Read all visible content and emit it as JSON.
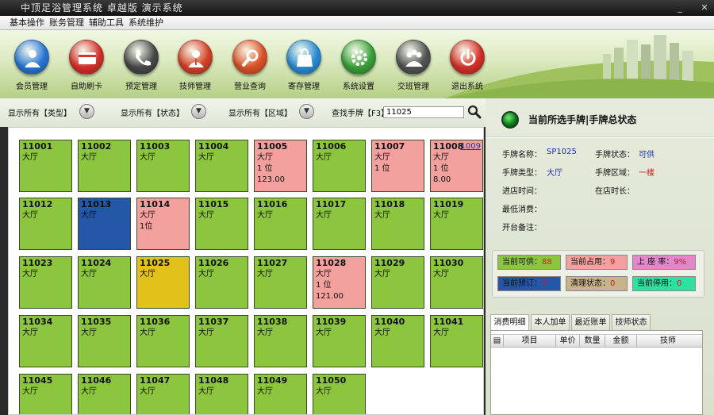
{
  "window": {
    "title": "中顶足浴管理系统  卓越版  演示系统"
  },
  "menu": [
    "基本操作",
    "账务管理",
    "辅助工具",
    "系统维护"
  ],
  "toolbar": [
    {
      "label": "会员管理",
      "icon": "member-icon",
      "color": "#2a78d8"
    },
    {
      "label": "自助刷卡",
      "icon": "card-icon",
      "color": "#d8332a"
    },
    {
      "label": "预定管理",
      "icon": "phone-icon",
      "color": "#4a4a4a"
    },
    {
      "label": "技师管理",
      "icon": "technician-icon",
      "color": "#d8432a"
    },
    {
      "label": "营业查询",
      "icon": "search-icon",
      "color": "#e0552a"
    },
    {
      "label": "寄存管理",
      "icon": "bag-icon",
      "color": "#2b8fd8"
    },
    {
      "label": "系统设置",
      "icon": "gear-icon",
      "color": "#3ba43a"
    },
    {
      "label": "交班管理",
      "icon": "shift-icon",
      "color": "#555555"
    },
    {
      "label": "退出系统",
      "icon": "power-icon",
      "color": "#d8332a"
    }
  ],
  "filters": {
    "type": "显示所有【类型】",
    "state": "显示所有【状态】",
    "area": "显示所有【区域】",
    "search_label": "查找手牌【F3】",
    "search_value": "11025"
  },
  "colors": {
    "available": "#8cc63f",
    "occupied": "#f2a19e",
    "reserved": "#2457a8",
    "cleaning": "#e2c21a",
    "disabled": "#2fe0a0"
  },
  "cards": [
    {
      "num": "11001",
      "area": "大厅",
      "status": "available"
    },
    {
      "num": "11002",
      "area": "大厅",
      "status": "available"
    },
    {
      "num": "11003",
      "area": "大厅",
      "status": "available"
    },
    {
      "num": "11004",
      "area": "大厅",
      "status": "available"
    },
    {
      "num": "11005",
      "area": "大厅",
      "seat": "1 位",
      "amount": "123.00",
      "status": "occupied"
    },
    {
      "num": "11006",
      "area": "大厅",
      "status": "available"
    },
    {
      "num": "11007",
      "area": "大厅",
      "seat": "1 位",
      "status": "occupied"
    },
    {
      "num": "11008",
      "link": "1009",
      "area": "大厅",
      "seat": "1 位",
      "amount": "8.00",
      "status": "occupied"
    },
    {
      "num": "11012",
      "area": "大厅",
      "status": "available"
    },
    {
      "num": "11013",
      "area": "大厅",
      "status": "reserved"
    },
    {
      "num": "11014",
      "area": "大厅",
      "seat": "1位",
      "status": "occupied"
    },
    {
      "num": "11015",
      "area": "大厅",
      "status": "available"
    },
    {
      "num": "11016",
      "area": "大厅",
      "status": "available"
    },
    {
      "num": "11017",
      "area": "大厅",
      "status": "available"
    },
    {
      "num": "11018",
      "area": "大厅",
      "status": "available"
    },
    {
      "num": "11019",
      "area": "大厅",
      "status": "available"
    },
    {
      "num": "11023",
      "area": "大厅",
      "status": "available"
    },
    {
      "num": "11024",
      "area": "大厅",
      "status": "available"
    },
    {
      "num": "11025",
      "area": "大厅",
      "status": "cleaning"
    },
    {
      "num": "11026",
      "area": "大厅",
      "status": "available"
    },
    {
      "num": "11027",
      "area": "大厅",
      "status": "available"
    },
    {
      "num": "11028",
      "area": "大厅",
      "seat": "1 位",
      "amount": "121.00",
      "status": "occupied"
    },
    {
      "num": "11029",
      "area": "大厅",
      "status": "available"
    },
    {
      "num": "11030",
      "area": "大厅",
      "status": "available"
    },
    {
      "num": "11034",
      "area": "大厅",
      "status": "available"
    },
    {
      "num": "11035",
      "area": "大厅",
      "status": "available"
    },
    {
      "num": "11036",
      "area": "大厅",
      "status": "available"
    },
    {
      "num": "11037",
      "area": "大厅",
      "status": "available"
    },
    {
      "num": "11038",
      "area": "大厅",
      "status": "available"
    },
    {
      "num": "11039",
      "area": "大厅",
      "status": "available"
    },
    {
      "num": "11040",
      "area": "大厅",
      "status": "available"
    },
    {
      "num": "11041",
      "area": "大厅",
      "status": "available"
    },
    {
      "num": "11045",
      "area": "大厅",
      "status": "available"
    },
    {
      "num": "11046",
      "area": "大厅",
      "status": "available"
    },
    {
      "num": "11047",
      "area": "大厅",
      "status": "available"
    },
    {
      "num": "11048",
      "area": "大厅",
      "status": "available"
    },
    {
      "num": "11049",
      "area": "大厅",
      "status": "available"
    },
    {
      "num": "11050",
      "area": "大厅",
      "status": "available"
    }
  ],
  "panel": {
    "title": "当前所选手牌|手牌总状态",
    "fields": [
      {
        "label": "手牌名称：",
        "value": "SP1025"
      },
      {
        "label": "手牌状态：",
        "value": "可供"
      },
      {
        "label": "手牌类型：",
        "value": "大厅"
      },
      {
        "label": "手牌区域：",
        "value": "一楼"
      },
      {
        "label": "进店时间：",
        "value": ""
      },
      {
        "label": "在店时长：",
        "value": ""
      },
      {
        "label": "最低消费：",
        "value": ""
      },
      {
        "label": "开台备注：",
        "value": ""
      }
    ],
    "legend": [
      {
        "label": "当前可供：",
        "value": "88",
        "color": "#8cc63f"
      },
      {
        "label": "当前占用：",
        "value": "9",
        "color": "#f2a19e"
      },
      {
        "label": "上 座 率：",
        "value": "9%",
        "color": "#e088c8"
      },
      {
        "label": "当前预订：",
        "value": "0",
        "color": "#2457a8"
      },
      {
        "label": "清理状态：",
        "value": "0",
        "color": "#c8b48a"
      },
      {
        "label": "当前停用：",
        "value": "0",
        "color": "#2fe0a0"
      }
    ],
    "tabs": [
      "消费明细",
      "本人加单",
      "最近账单",
      "技师状态"
    ],
    "table_headers": [
      "项目",
      "单价",
      "数量",
      "金额",
      "技师"
    ]
  }
}
